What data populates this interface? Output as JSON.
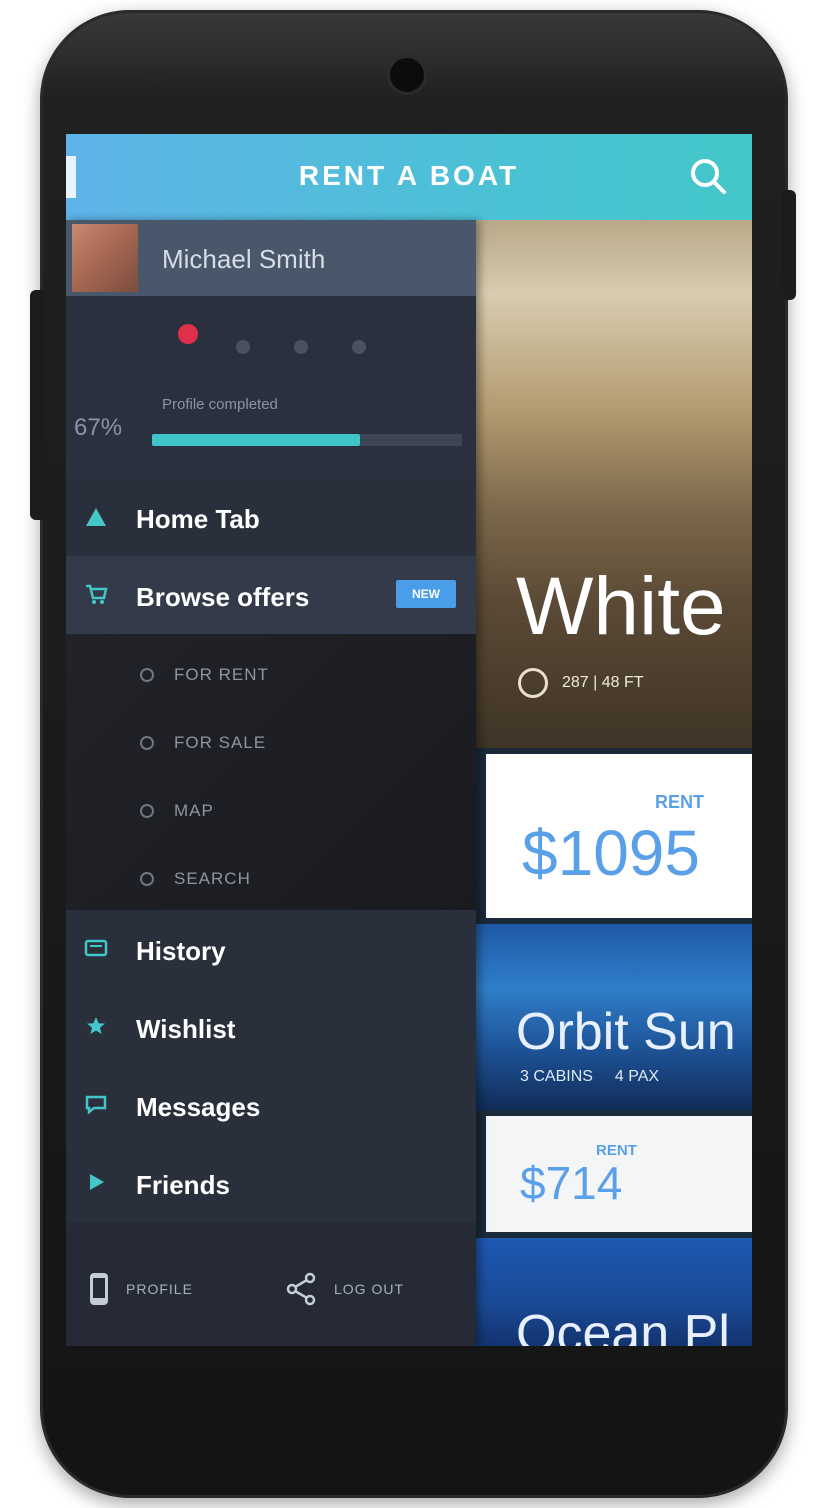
{
  "app": {
    "title": "RENT A BOAT",
    "accent_color": "#43c7c9"
  },
  "header": {
    "search_icon": "search-icon"
  },
  "profile": {
    "name": "Michael Smith",
    "avatar": "avatar"
  },
  "progress": {
    "percent_text": "67%",
    "label": "Profile completed",
    "fraction": 0.67
  },
  "nav": {
    "items": [
      {
        "label": "Home Tab",
        "icon": "home-icon"
      },
      {
        "label": "Browse offers",
        "icon": "cart-icon",
        "badge": "NEW"
      },
      {
        "label": "History",
        "icon": "history-icon"
      },
      {
        "label": "Wishlist",
        "icon": "star-icon"
      },
      {
        "label": "Messages",
        "icon": "chat-icon"
      },
      {
        "label": "Friends",
        "icon": "friends-icon"
      }
    ],
    "sub_items": [
      {
        "label": "FOR RENT"
      },
      {
        "label": "FOR SALE"
      },
      {
        "label": "MAP"
      },
      {
        "label": "SEARCH"
      }
    ]
  },
  "footer": {
    "profile_label": "PROFILE",
    "logout_label": "LOG OUT"
  },
  "listings": [
    {
      "title": "White",
      "meta": "287 | 48 FT",
      "price_label": null,
      "price": null
    },
    {
      "price_label": "RENT",
      "price": "$1095"
    },
    {
      "title": "Orbit Sun",
      "meta_a": "3 CABINS",
      "meta_b": "4 PAX"
    },
    {
      "price_label": "RENT",
      "price": "$714"
    },
    {
      "title": "Ocean Pl"
    }
  ]
}
